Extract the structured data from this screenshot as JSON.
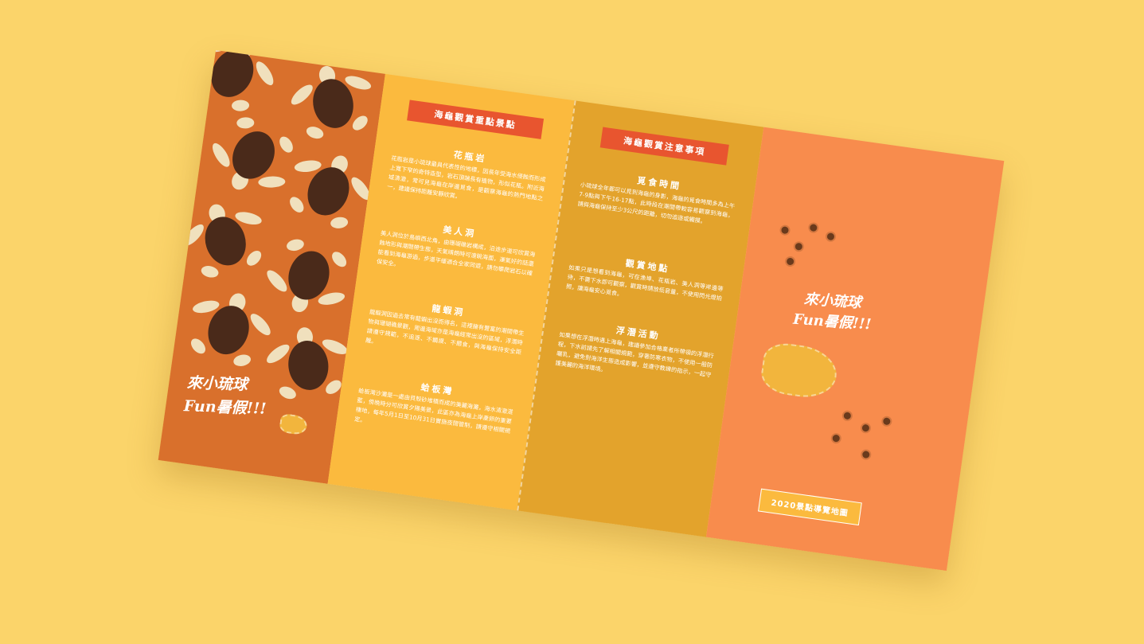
{
  "background_color": "#fbd46a",
  "panel1": {
    "slogan_line1": "來小琉球",
    "slogan_line2": "Fun暑假!!!"
  },
  "panel2": {
    "ribbon": "海龜觀賞重點景點",
    "sections": [
      {
        "title": "花瓶岩",
        "body": "花瓶岩是小琉球最具代表性的地標，因長年受海水侵蝕而形成上寬下窄的奇特造型，岩石頂端長有植物，形似花瓶。附近海域清澈，常可見海龜在岸邊覓食，是觀察海龜的熱門地點之一，建議保持距離安靜欣賞。"
      },
      {
        "title": "美人洞",
        "body": "美人洞位於島嶼西北角，由珊瑚礁岩構成，沿途步道可欣賞海蝕地形與潮間帶生態，天氣晴朗時可遠眺海面，運氣好的話還能看到海龜游過，步道平緩適合全家同遊，請勿攀爬岩石以確保安全。"
      },
      {
        "title": "龍蝦洞",
        "body": "龍蝦洞因過去常有龍蝦出沒而得名，這裡擁有豐富的潮間帶生物與珊瑚礁景觀，周邊海域亦是海龜經常出沒的區域，浮潛時請遵守規範，不追逐、不觸摸、不餵食，與海龜保持安全距離。"
      },
      {
        "title": "蛤板灣",
        "body": "蛤板灣沙灘是一處由貝殼砂堆積而成的美麗海灘，海水清澈湛藍，傍晚時分可欣賞夕陽美景，此區亦為海龜上岸產卵的重要棲地，每年5月1日至10月31日實施夜間管制，請遵守相關規定。"
      }
    ]
  },
  "panel3": {
    "ribbon": "海龜觀賞注意事項",
    "sections": [
      {
        "title": "覓食時間",
        "body": "小琉球全年都可以見到海龜的身影，海龜的覓食時間多為上午7-9點與下午16-17點，此時段在潮間帶較容易觀察到海龜，請與海龜保持至少3公尺的距離，切勿追逐或觸摸。"
      },
      {
        "title": "觀賞地點",
        "body": "如果只是想看到海龜，可在漁埠、花瓶岩、美人洞等岸邊等待，不需下水即可觀察，觀賞時請放低音量，不使用閃光燈拍照，讓海龜安心覓食。"
      },
      {
        "title": "浮潛活動",
        "body": "如果想在浮潛時遇上海龜，建議參加合格業者所帶領的浮潛行程，下水前請先了解相關規範，穿著防寒衣物，不使用一般防曬乳，避免對海洋生態造成影響，並遵守教練的指示，一起守護美麗的海洋環境。"
      }
    ]
  },
  "panel4": {
    "slogan_line1": "來小琉球",
    "slogan_line2": "Fun暑假!!!",
    "map_ribbon": "2020景點導覽地圖"
  }
}
